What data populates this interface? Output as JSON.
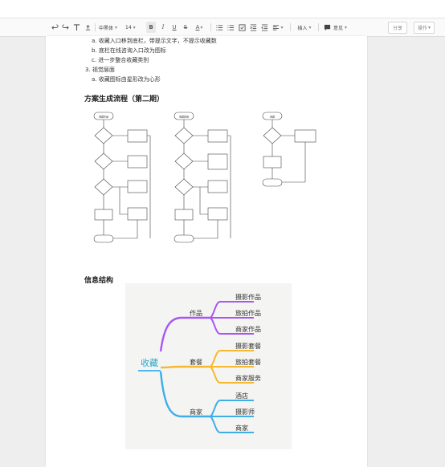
{
  "toolbar": {
    "font_family": "中黑体",
    "font_size": "14",
    "insert_label": "插入",
    "comment_label": "意见",
    "share_label": "分享",
    "action_label": "操作"
  },
  "content": {
    "list_a": "a. 收藏入口移到底栏，带提示文字，不提示收藏数",
    "list_b": "b. 底栏在线咨询入口改为图标",
    "list_c": "c. 进一步整合收藏类别",
    "list_3": "3. 视觉层面",
    "list_3a": "a. 收藏图标由星形改为心形",
    "heading_flow": "方案生成流程（第二期）",
    "heading_info": "信息结构"
  },
  "flowcharts": [
    {
      "start": "收藏作品"
    },
    {
      "start": "收藏套餐"
    },
    {
      "start": "收藏"
    }
  ],
  "mindmap": {
    "root": "收藏",
    "branches": [
      {
        "label": "作品",
        "color": "#a855f7",
        "leaves": [
          "摄影作品",
          "旅拍作品",
          "商家作品"
        ]
      },
      {
        "label": "套餐",
        "color": "#f5b82e",
        "leaves": [
          "摄影套餐",
          "旅拍套餐",
          "商家服务"
        ]
      },
      {
        "label": "商家",
        "color": "#3daeea",
        "leaves": [
          "酒店",
          "摄影师",
          "商家"
        ]
      }
    ]
  },
  "colors": {
    "root_text": "#2aa6c9",
    "background": "#eeeeee",
    "page": "#ffffff"
  }
}
